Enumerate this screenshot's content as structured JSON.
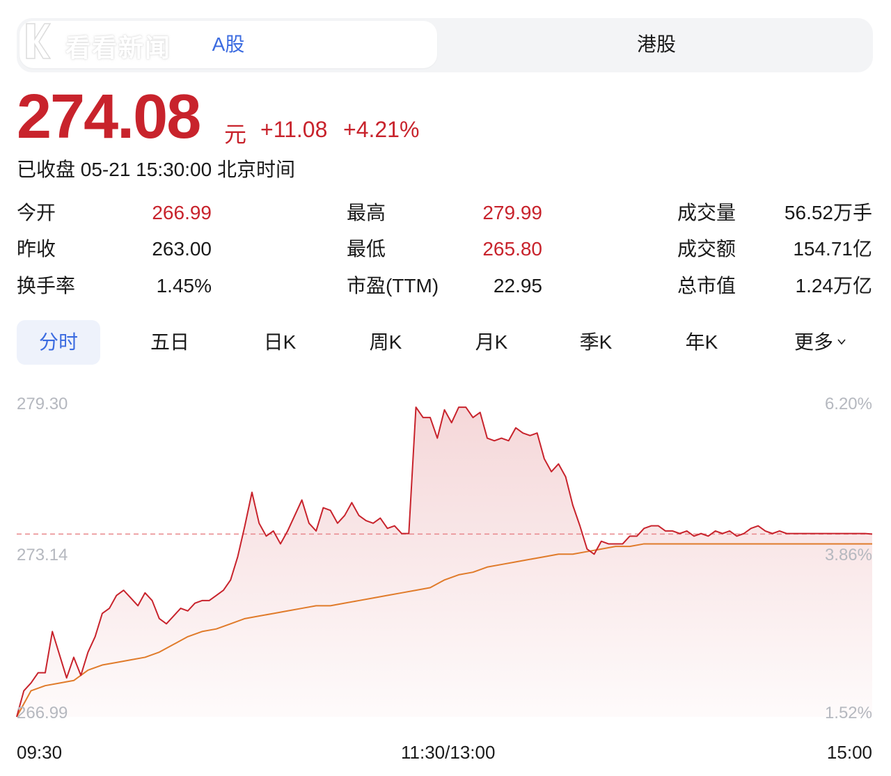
{
  "logo": {
    "text": "看看新闻"
  },
  "market_tabs": [
    {
      "label": "A股",
      "active": true
    },
    {
      "label": "港股",
      "active": false
    }
  ],
  "quote": {
    "price": "274.08",
    "currency": "元",
    "change": "+11.08",
    "change_pct": "+4.21%",
    "status": "已收盘 05-21 15:30:00 北京时间"
  },
  "stats": [
    {
      "label": "今开",
      "value": "266.99",
      "color": "#c8232c"
    },
    {
      "label": "昨收",
      "value": "263.00",
      "color": "#1a1a1a"
    },
    {
      "label": "换手率",
      "value": "1.45%",
      "color": "#1a1a1a"
    },
    {
      "label": "最高",
      "value": "279.99",
      "color": "#c8232c"
    },
    {
      "label": "最低",
      "value": "265.80",
      "color": "#c8232c"
    },
    {
      "label": "市盈(TTM)",
      "value": "22.95",
      "color": "#1a1a1a"
    },
    {
      "label": "成交量",
      "value": "56.52万手",
      "color": "#1a1a1a"
    },
    {
      "label": "成交额",
      "value": "154.71亿",
      "color": "#1a1a1a"
    },
    {
      "label": "总市值",
      "value": "1.24万亿",
      "color": "#1a1a1a"
    }
  ],
  "period_tabs": [
    {
      "label": "分时",
      "active": true
    },
    {
      "label": "五日"
    },
    {
      "label": "日K"
    },
    {
      "label": "周K"
    },
    {
      "label": "月K"
    },
    {
      "label": "季K"
    },
    {
      "label": "年K"
    },
    {
      "label": "更多"
    }
  ],
  "chart_data": {
    "type": "line",
    "y_left_ticks": [
      "279.30",
      "273.14",
      "266.99"
    ],
    "y_right_ticks": [
      "6.20%",
      "3.86%",
      "1.52%"
    ],
    "x_ticks": [
      "09:30",
      "11:30/13:00",
      "15:00"
    ],
    "ylim": [
      266.99,
      279.3
    ],
    "reference_price": 274.08,
    "colors": {
      "price": "#c8232c",
      "average": "#e07b2a",
      "reference": "#e8868b"
    },
    "series": [
      {
        "role": "price",
        "x": [
          0,
          2,
          4,
          6,
          8,
          10,
          12,
          14,
          16,
          18,
          20,
          22,
          24,
          26,
          28,
          30,
          32,
          34,
          36,
          38,
          40,
          42,
          44,
          46,
          48,
          50,
          52,
          54,
          56,
          58,
          60,
          62,
          64,
          66,
          68,
          70,
          72,
          74,
          76,
          78,
          80,
          82,
          84,
          86,
          88,
          90,
          92,
          94,
          96,
          98,
          100,
          102,
          104,
          106,
          108,
          110,
          112,
          114,
          116,
          118,
          120,
          122,
          124,
          126,
          128,
          130,
          132,
          134,
          136,
          138,
          140,
          142,
          144,
          146,
          148,
          150,
          152,
          154,
          156,
          158,
          160,
          162,
          164,
          166,
          168,
          170,
          172,
          174,
          176,
          178,
          180,
          182,
          184,
          186,
          188,
          190,
          192,
          194,
          196,
          198,
          200,
          202,
          204,
          206,
          208,
          210,
          212,
          214,
          216,
          218,
          220,
          222,
          224,
          226,
          228,
          230,
          232,
          234,
          236,
          238,
          240
        ],
        "values": [
          266.99,
          268.0,
          268.3,
          268.7,
          268.7,
          270.3,
          269.4,
          268.5,
          269.3,
          268.6,
          269.5,
          270.1,
          271.0,
          271.2,
          271.7,
          271.9,
          271.6,
          271.3,
          271.8,
          271.5,
          270.8,
          270.6,
          270.9,
          271.2,
          271.1,
          271.4,
          271.5,
          271.5,
          271.7,
          271.9,
          272.3,
          273.2,
          274.4,
          275.7,
          274.5,
          274.0,
          274.2,
          273.7,
          274.2,
          274.8,
          275.4,
          274.5,
          274.2,
          275.1,
          275.0,
          274.5,
          274.8,
          275.3,
          274.8,
          274.6,
          274.5,
          274.7,
          274.3,
          274.4,
          274.1,
          274.1,
          279.0,
          278.6,
          278.6,
          277.8,
          278.9,
          278.4,
          279.0,
          279.0,
          278.6,
          278.8,
          277.8,
          277.7,
          277.8,
          277.7,
          278.2,
          278.0,
          277.9,
          278.0,
          277.0,
          276.5,
          276.8,
          276.3,
          275.2,
          274.4,
          273.5,
          273.3,
          273.8,
          273.7,
          273.7,
          273.7,
          274.0,
          274.0,
          274.3,
          274.4,
          274.4,
          274.2,
          274.2,
          274.1,
          274.2,
          274.0,
          274.1,
          274.0,
          274.2,
          274.1,
          274.2,
          274.0,
          274.1,
          274.3,
          274.4,
          274.2,
          274.1,
          274.2,
          274.1,
          274.1,
          274.1,
          274.1,
          274.1,
          274.1,
          274.1,
          274.1,
          274.1,
          274.1,
          274.1,
          274.1,
          274.08
        ]
      },
      {
        "role": "average",
        "x": [
          0,
          4,
          8,
          12,
          16,
          20,
          24,
          28,
          32,
          36,
          40,
          44,
          48,
          52,
          56,
          60,
          64,
          68,
          72,
          76,
          80,
          84,
          88,
          92,
          96,
          100,
          104,
          108,
          112,
          116,
          120,
          124,
          128,
          132,
          136,
          140,
          144,
          148,
          152,
          156,
          160,
          164,
          168,
          172,
          176,
          180,
          184,
          188,
          192,
          196,
          200,
          204,
          208,
          212,
          216,
          220,
          224,
          228,
          232,
          236,
          240
        ],
        "values": [
          266.99,
          268.0,
          268.2,
          268.3,
          268.4,
          268.8,
          269.0,
          269.1,
          269.2,
          269.3,
          269.5,
          269.8,
          270.1,
          270.3,
          270.4,
          270.6,
          270.8,
          270.9,
          271.0,
          271.1,
          271.2,
          271.3,
          271.3,
          271.4,
          271.5,
          271.6,
          271.7,
          271.8,
          271.9,
          272.0,
          272.3,
          272.5,
          272.6,
          272.8,
          272.9,
          273.0,
          273.1,
          273.2,
          273.3,
          273.3,
          273.4,
          273.5,
          273.6,
          273.6,
          273.7,
          273.7,
          273.7,
          273.7,
          273.7,
          273.7,
          273.7,
          273.7,
          273.7,
          273.7,
          273.7,
          273.7,
          273.7,
          273.7,
          273.7,
          273.7,
          273.7
        ]
      }
    ]
  }
}
